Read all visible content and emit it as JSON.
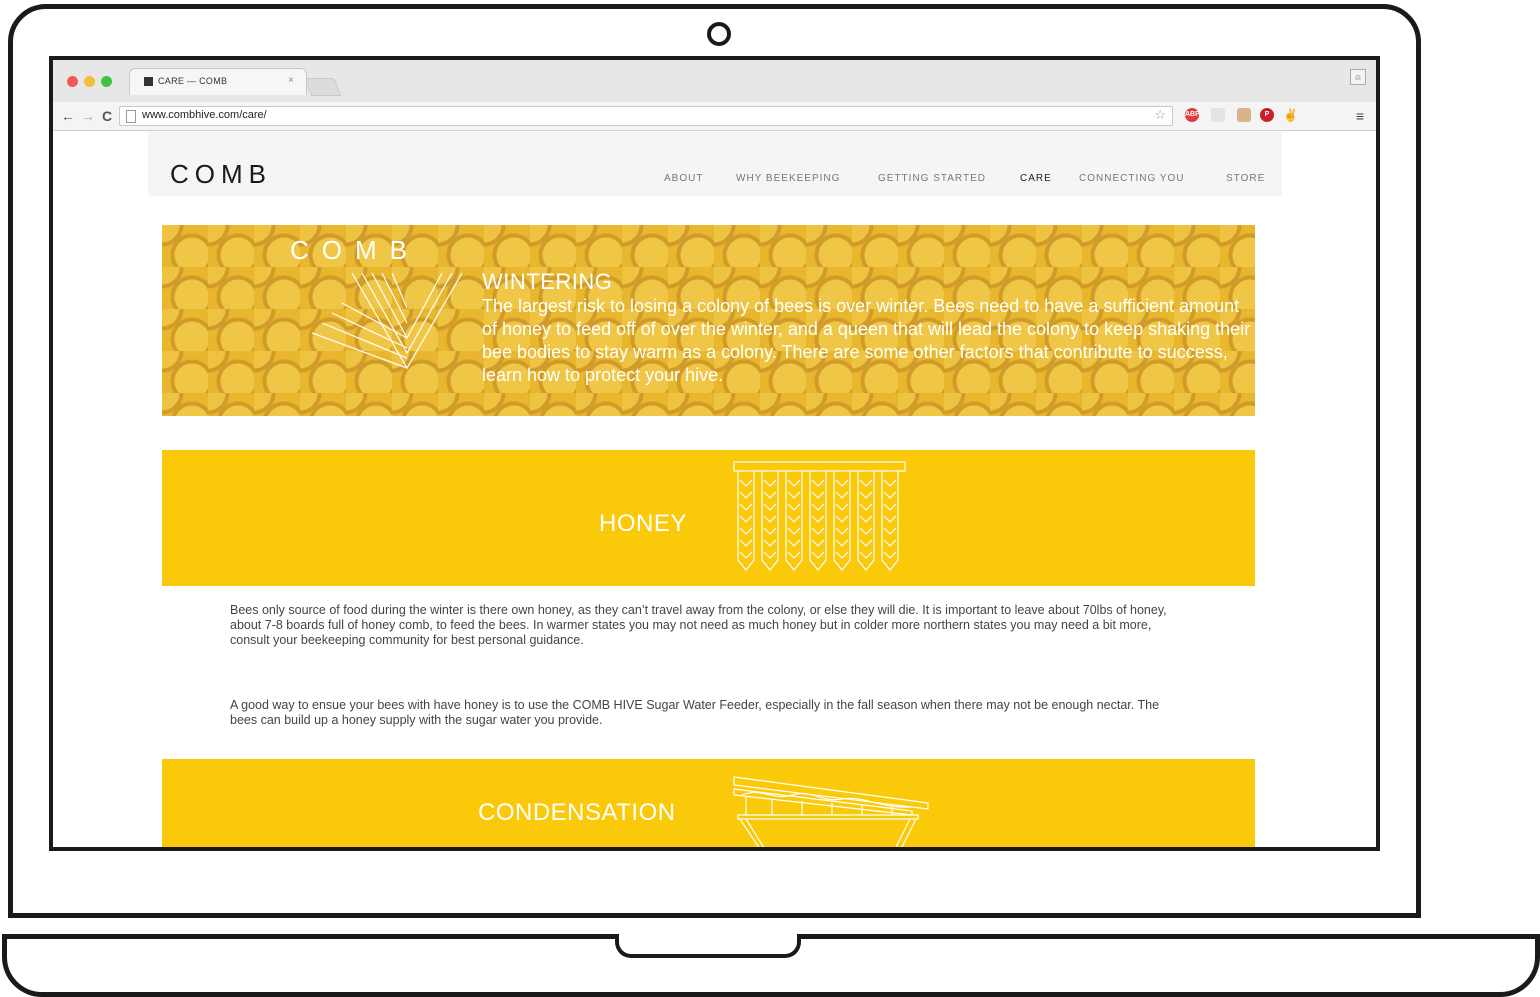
{
  "browser": {
    "tab_title": "CARE — COMB",
    "tab_close": "×",
    "url": "www.combhive.com/care/",
    "icons": [
      "back-arrow-icon",
      "forward-arrow-icon",
      "reload-icon",
      "page-icon",
      "star-icon",
      "adblock-icon",
      "shield-icon",
      "stack-icon",
      "pinterest-icon",
      "bug-icon",
      "menu-icon",
      "profile-icon"
    ]
  },
  "site": {
    "logo": "COMB",
    "nav": [
      {
        "label": "ABOUT"
      },
      {
        "label": "WHY BEEKEEPING"
      },
      {
        "label": "GETTING STARTED"
      },
      {
        "label": "CARE",
        "active": true
      },
      {
        "label": "CONNECTING YOU"
      },
      {
        "label": "STORE"
      }
    ]
  },
  "hero": {
    "logo": "COMB",
    "title": "WINTERING",
    "body": "The largest risk to losing a colony of bees is over winter. Bees need to have a sufficient amount of honey to feed off of over the winter, and a queen that will lead the colony to keep shaking their bee bodies to stay warm as a colony. There are some other factors that contribute to success, learn how to protect your hive."
  },
  "sections": {
    "honey": {
      "title": "HONEY",
      "paragraph_1": "Bees only source of food during the winter is there own honey, as they can’t travel away from the colony, or else they will die. It is important to leave about 70lbs of honey, about 7-8 boards full of honey comb, to feed the bees. In warmer states you may not need as much honey but in colder more northern states you may need a bit more, consult your beekeeping community for best personal guidance.",
      "paragraph_2": "A good way to ensue your bees with have honey is to use the COMB HIVE Sugar Water Feeder, especially in the fall season when there may not be enough nectar. The bees can build up a honey supply with the sugar water you provide."
    },
    "condensation": {
      "title": "CONDENSATION"
    }
  },
  "colors": {
    "accent_yellow": "#fac909",
    "hero_yellow": "#e8b92f",
    "text": "#444444",
    "frame": "#1a1a1a"
  }
}
